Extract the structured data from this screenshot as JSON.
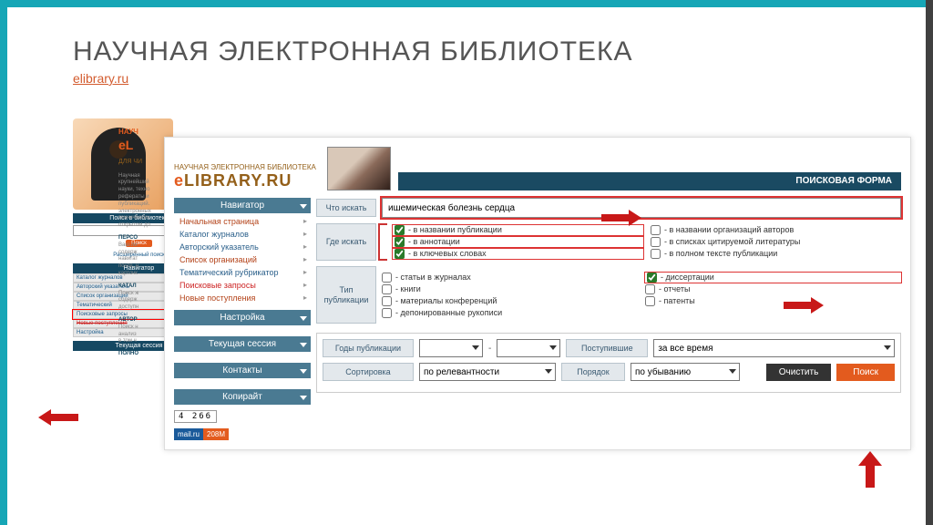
{
  "slide": {
    "title": "НАУЧНАЯ ЭЛЕКТРОННАЯ БИБЛИОТЕКА",
    "link": "elibrary.ru"
  },
  "bg": {
    "brand_top": "НАУЧ",
    "brand_main": "eL",
    "tagline": "ДЛЯ ЧИ",
    "search_head": "Поиск в библиотеке",
    "search_btn": "Поиск",
    "adv_search": "Расширенный поиск",
    "nav_head": "Навигатор",
    "nav_items": [
      "Каталог журналов",
      "Авторский указатель",
      "Список организаций",
      "Тематический",
      "Поисковые запросы",
      "Новые поступления",
      "Настройка"
    ],
    "sess": "Текущая сессия",
    "col": {
      "p1": "Научная\nкрупнейший\nнауки, техно\nрефераты и\nпубликаций.\nэлектронных\nтехнических\nоткрытом до",
      "h1": "ПЕРСО",
      "t1": "Ваш ли\nсодерж\nнавигат\nпочте, н\nкарточк",
      "h2": "КАТАЛ",
      "t2": "Поиск ж\nсодерж\nдоступн",
      "h3": "АВТОР",
      "t3": "Поиск н\nанализ\nв том ч",
      "h4": "ПОЛНО"
    }
  },
  "fg": {
    "logo_top": "НАУЧНАЯ ЭЛЕКТРОННАЯ БИБЛИОТЕКА",
    "logo_main_pre": "e",
    "logo_main": "LIBRARY.RU",
    "header_bar": "ПОИСКОВАЯ ФОРМА",
    "nav": {
      "head1": "Навигатор",
      "items": [
        "Начальная страница",
        "Каталог журналов",
        "Авторский указатель",
        "Список организаций",
        "Тематический рубрикатор",
        "Поисковые запросы",
        "Новые поступления"
      ],
      "head2": "Настройка",
      "head3": "Текущая сессия",
      "head4": "Контакты",
      "head5": "Копирайт"
    },
    "form": {
      "what_label": "Что искать",
      "what_value": "ишемическая болезнь сердца",
      "where_label": "Где искать",
      "where_opts_left": [
        "- в названии публикации",
        "- в аннотации",
        "- в ключевых словах"
      ],
      "where_opts_right": [
        "- в названии организаций авторов",
        "- в списках цитируемой литературы",
        "- в полном тексте публикации"
      ],
      "where_checked_left": [
        true,
        true,
        true
      ],
      "where_checked_right": [
        false,
        false,
        false
      ],
      "type_label": "Тип публикации",
      "type_left": [
        "- статьи в журналах",
        "- книги",
        "- материалы конференций",
        "- депонированные рукописи"
      ],
      "type_right": [
        "- диссертации",
        "- отчеты",
        "- патенты"
      ],
      "type_checked_left": [
        false,
        false,
        false,
        false
      ],
      "type_checked_right": [
        true,
        false,
        false
      ]
    },
    "filters": {
      "years_label": "Годы публикации",
      "dash": "-",
      "received_label": "Поступившие",
      "received_val": "за все время",
      "sort_label": "Сортировка",
      "sort_val": "по релевантности",
      "order_label": "Порядок",
      "order_val": "по убыванию",
      "clear_btn": "Очистить",
      "search_btn": "Поиск"
    },
    "mailru": {
      "count": "4 266",
      "badge": "mail.ru",
      "num": "208M"
    }
  }
}
